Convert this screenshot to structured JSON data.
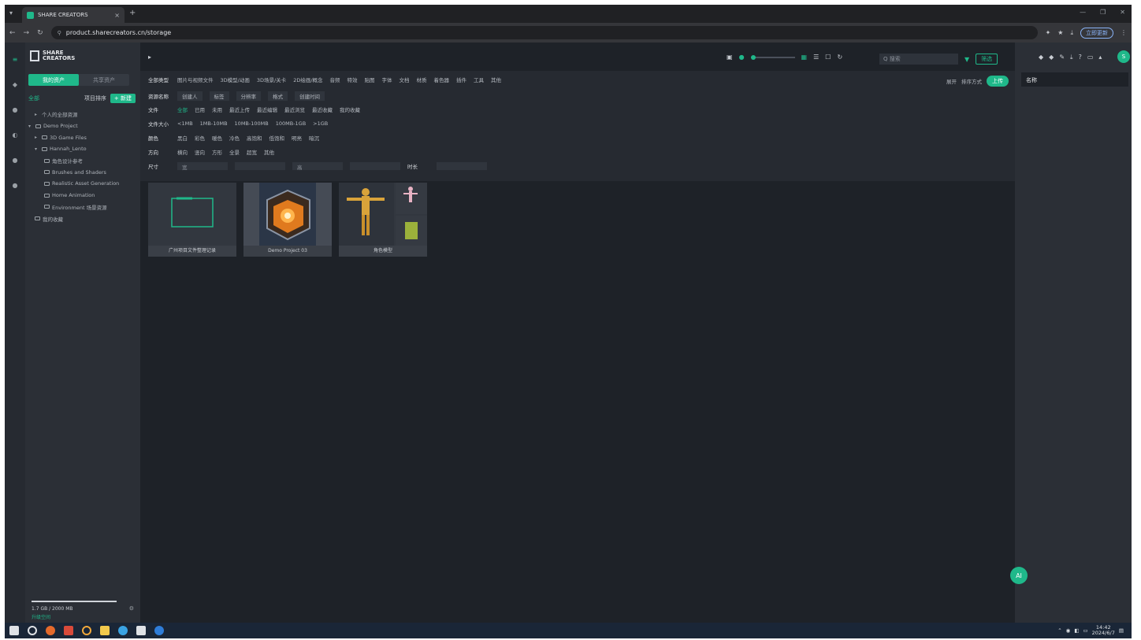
{
  "browser": {
    "tab_title": "SHARE CREATORS",
    "tab_close": "×",
    "new_tab": "+",
    "url": "product.sharecreators.cn/storage",
    "update_label": "立即更新",
    "window_controls": [
      "—",
      "❐",
      "✕"
    ]
  },
  "brand": {
    "logo_text": "SHARE CREATORS"
  },
  "sidebar": {
    "tabs": [
      {
        "label": "我的资产"
      },
      {
        "label": "共享资产"
      }
    ],
    "tree_header": "全部",
    "tree_sort": "项目排序",
    "new_button": "+ 新建",
    "tree": [
      "个人的全部资源",
      "Demo Project",
      "3D Game Files",
      "Hannah_Lento",
      "角色设计参考",
      "Brushes and Shaders",
      "Realistic Asset Generation",
      "Home Animation",
      "Environment 场景资源",
      "我的收藏"
    ],
    "usage_text": "1.7 GB / 2000 MB",
    "usage_link": "升级空间",
    "usage_fraction": 0.85
  },
  "topbar": {
    "search_placeholder": "Q 搜索",
    "filter_pill": "筛选",
    "zoom_level": 0
  },
  "filters": {
    "row1": [
      "全部类型",
      "图片与视频文件",
      "3D模型/动画",
      "3D场景/关卡",
      "2D绘画/概念",
      "音频",
      "特效",
      "贴图",
      "字体",
      "文档",
      "材质",
      "着色器",
      "插件",
      "工具",
      "其他"
    ],
    "row2": [
      "资源名称",
      "创建人",
      "标签",
      "分辨率",
      "格式",
      "创建时间"
    ],
    "row3": [
      "文件",
      "全部",
      "已用",
      "未用",
      "最近上传",
      "最近编辑",
      "最近浏览",
      "最近收藏",
      "我的收藏"
    ],
    "row4": [
      "文件大小",
      "<1MB",
      "1MB-10MB",
      "10MB-100MB",
      "100MB-1GB",
      ">1GB"
    ],
    "row5": [
      "颜色",
      "黑白",
      "彩色",
      "暖色",
      "冷色",
      "高饱和",
      "低饱和",
      "明亮",
      "暗沉"
    ],
    "row6": [
      "方向",
      "横向",
      "竖向",
      "方形",
      "全景",
      "超宽",
      "其他"
    ],
    "row7": [
      "尺寸",
      "宽",
      "高",
      "时长"
    ],
    "right_labels": [
      "展开",
      "排序方式"
    ],
    "upload_label": "上传"
  },
  "assets": [
    {
      "name": "广州项目文件整理记录"
    },
    {
      "name": "Demo Project 03"
    },
    {
      "name": "角色模型"
    }
  ],
  "right_panel": {
    "input_value": "名称",
    "avatar": "S"
  },
  "fab": {
    "label": "AI"
  },
  "taskbar": {
    "time": "14:42",
    "date": "2024/6/7"
  },
  "colors": {
    "accent": "#1fb88a",
    "bg": "#1e2228",
    "panel": "#2b2f36"
  }
}
